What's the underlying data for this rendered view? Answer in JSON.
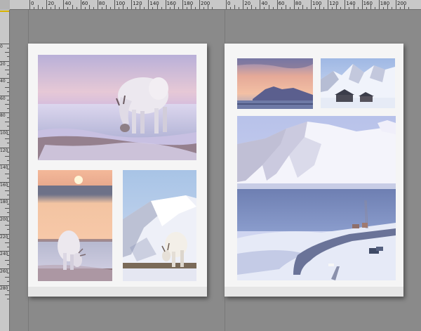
{
  "rulers": {
    "top_left_labels": [
      "0",
      "20",
      "40",
      "60",
      "80",
      "100",
      "120",
      "140",
      "160",
      "180",
      "200"
    ],
    "top_right_labels": [
      "0",
      "20",
      "40",
      "60",
      "80",
      "100",
      "120",
      "140",
      "160",
      "180",
      "200"
    ],
    "left_labels": [
      "0",
      "20",
      "40",
      "60",
      "80",
      "100",
      "120",
      "140",
      "160",
      "180",
      "200",
      "220",
      "240",
      "260",
      "280"
    ]
  },
  "spread": {
    "left_page": {
      "photos": [
        {
          "subject": "reindeer-grazing-at-dusk"
        },
        {
          "subject": "reindeer-at-sunset-shore"
        },
        {
          "subject": "reindeer-by-snowy-mountain"
        }
      ]
    },
    "right_page": {
      "photos": [
        {
          "subject": "mountain-silhouette-at-dusk"
        },
        {
          "subject": "cabins-below-snowy-mountains"
        },
        {
          "subject": "fjord-and-snowy-mountain-village"
        }
      ]
    }
  },
  "colors": {
    "workspace": "#8a8a8a",
    "page": "#f5f5f5",
    "ruler": "#c8c8c8"
  }
}
